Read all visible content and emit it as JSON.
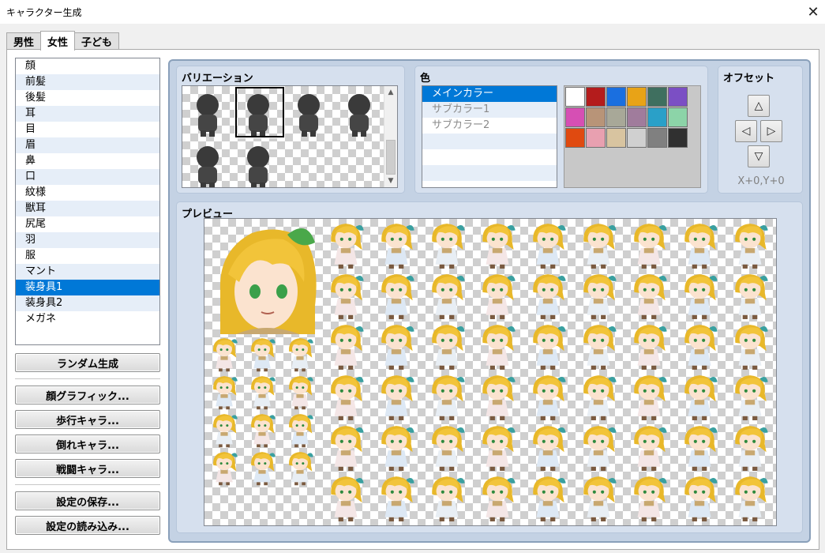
{
  "window": {
    "title": "キャラクター生成",
    "close_icon": "close-icon"
  },
  "tabs": [
    {
      "label": "男性",
      "active": false
    },
    {
      "label": "女性",
      "active": true
    },
    {
      "label": "子ども",
      "active": false
    }
  ],
  "parts": {
    "items": [
      "顔",
      "前髪",
      "後髪",
      "耳",
      "目",
      "眉",
      "鼻",
      "口",
      "紋様",
      "獣耳",
      "尻尾",
      "羽",
      "服",
      "マント",
      "装身具1",
      "装身具2",
      "メガネ"
    ],
    "selected_index": 14
  },
  "buttons": {
    "random": "ランダム生成",
    "face_graphic": "顔グラフィック...",
    "walk_char": "歩行キャラ...",
    "down_char": "倒れキャラ...",
    "battle_char": "戦闘キャラ...",
    "save_settings": "設定の保存...",
    "load_settings": "設定の読み込み..."
  },
  "variation": {
    "label": "バリエーション",
    "selected_index": 1,
    "count": 6
  },
  "color": {
    "label": "色",
    "items": [
      "メインカラー",
      "サブカラー1",
      "サブカラー2",
      "",
      "",
      ""
    ],
    "selected_index": 0,
    "swatches": [
      "#ffffff",
      "#b41c1c",
      "#1a6fe0",
      "#e8a317",
      "#3f6f5f",
      "#7b4fc4",
      "#d64fb4",
      "#b89478",
      "#a8a898",
      "#a07c9c",
      "#2aa0c8",
      "#8cd4a8",
      "#e04a10",
      "#e8a0b0",
      "#d8c4a0",
      "#d0d0d0",
      "#808080",
      "#303030"
    ],
    "selected_swatch": 0
  },
  "offset": {
    "label": "オフセット",
    "up": "△",
    "left": "◁",
    "right": "▷",
    "down": "▽",
    "value": "X+0,Y+0"
  },
  "preview": {
    "label": "プレビュー"
  }
}
